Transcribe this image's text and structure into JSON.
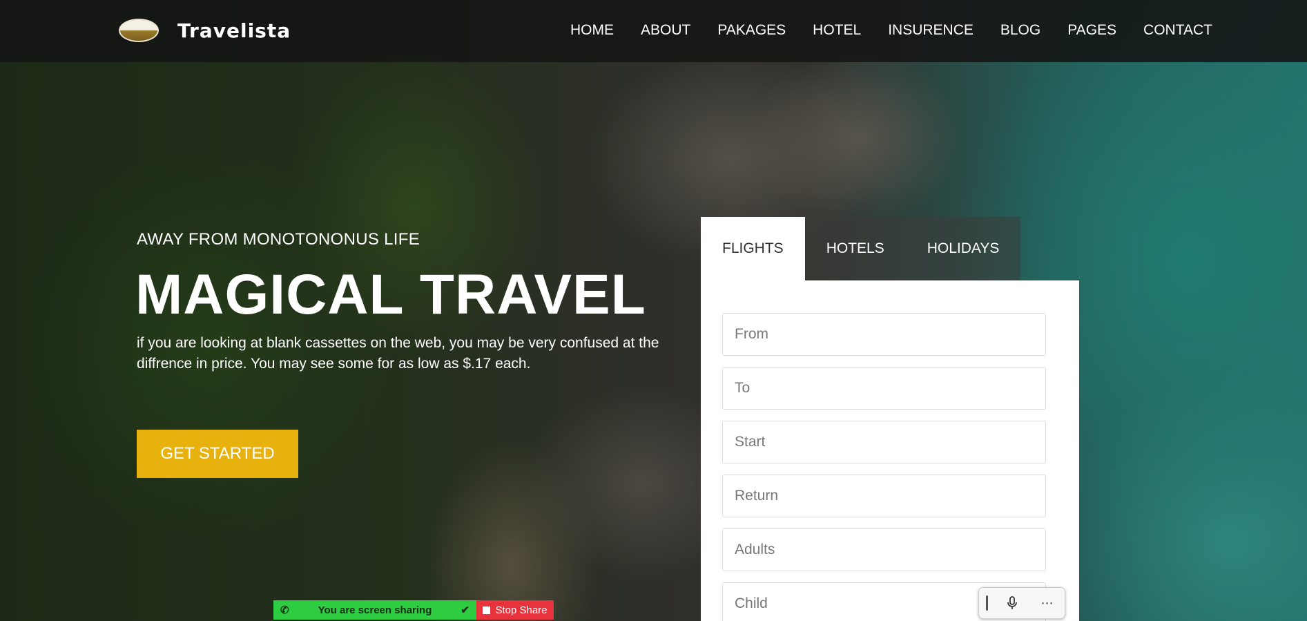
{
  "header": {
    "brand": "Travelista",
    "nav": [
      "HOME",
      "ABOUT",
      "PAKAGES",
      "HOTEL",
      "INSURENCE",
      "BLOG",
      "PAGES",
      "CONTACT"
    ]
  },
  "hero": {
    "kicker": "AWAY FROM MONOTONONUS LIFE",
    "title": "MAGICAL TRAVEL",
    "description": "if you are looking at blank cassettes on the web, you may be very confused at the diffrence in price. You may see some for as low as $.17 each.",
    "cta_label": "GET STARTED"
  },
  "booking": {
    "tabs": [
      "FLIGHTS",
      "HOTELS",
      "HOLIDAYS"
    ],
    "active_tab": "FLIGHTS",
    "fields": {
      "from": "From",
      "to": "To",
      "start": "Start",
      "return": "Return",
      "adults": "Adults",
      "child": "Child"
    }
  },
  "screen_share": {
    "status": "You are screen sharing",
    "stop_label": "Stop Share"
  },
  "colors": {
    "accent": "#e7b20d",
    "header_bg": "#141414",
    "share_green": "#2ecc40",
    "share_red": "#e8323c"
  }
}
